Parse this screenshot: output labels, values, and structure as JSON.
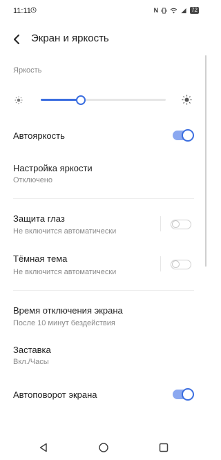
{
  "status": {
    "time": "11:11",
    "battery": "72",
    "icons": [
      "alarm-clock-icon",
      "nfc-icon",
      "vibrate-icon",
      "wifi-icon",
      "signal-icon",
      "battery-icon"
    ]
  },
  "header": {
    "title": "Экран и яркость"
  },
  "brightness": {
    "label": "Яркость",
    "level": 0.32
  },
  "items": {
    "auto_brightness": {
      "title": "Автояркость",
      "on": true
    },
    "brightness_settings": {
      "title": "Настройка яркости",
      "subtitle": "Отключено"
    },
    "eye_protection": {
      "title": "Защита глаз",
      "subtitle": "Не включится автоматически",
      "on": false
    },
    "dark_theme": {
      "title": "Тёмная тема",
      "subtitle": "Не включится автоматически",
      "on": false
    },
    "screen_timeout": {
      "title": "Время отключения экрана",
      "subtitle": "После 10 минут бездействия"
    },
    "screensaver": {
      "title": "Заставка",
      "subtitle": "Вкл./Часы"
    },
    "auto_rotate": {
      "title": "Автоповорот экрана",
      "on": true
    }
  },
  "colors": {
    "accent": "#3b6ee0",
    "accent_light": "#8ba8f0",
    "subtitle": "#8a8a8a"
  },
  "nav": {
    "icons": [
      "back-triangle-icon",
      "home-circle-icon",
      "recents-square-icon"
    ]
  }
}
